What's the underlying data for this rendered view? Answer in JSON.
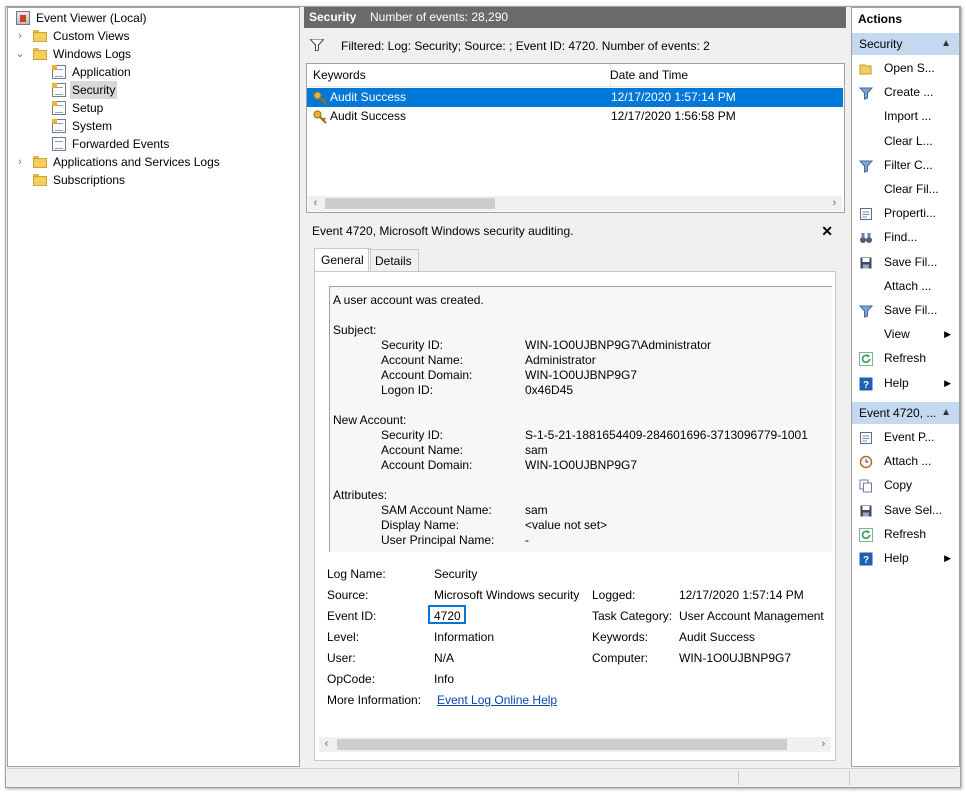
{
  "tree": {
    "root": "Event Viewer (Local)",
    "items": [
      {
        "label": "Custom Views"
      },
      {
        "label": "Windows Logs"
      },
      {
        "label": "Application"
      },
      {
        "label": "Security"
      },
      {
        "label": "Setup"
      },
      {
        "label": "System"
      },
      {
        "label": "Forwarded Events"
      },
      {
        "label": "Applications and Services Logs"
      },
      {
        "label": "Subscriptions"
      }
    ]
  },
  "log_header": {
    "title": "Security",
    "count": "Number of events: 28,290"
  },
  "filter_text": "Filtered: Log: Security; Source: ; Event ID: 4720. Number of events: 2",
  "columns": {
    "keywords": "Keywords",
    "datetime": "Date and Time"
  },
  "events": [
    {
      "keywords": "Audit Success",
      "datetime": "12/17/2020 1:57:14 PM"
    },
    {
      "keywords": "Audit Success",
      "datetime": "12/17/2020 1:56:58 PM"
    }
  ],
  "details": {
    "title": "Event 4720, Microsoft Windows security auditing.",
    "close": "✕",
    "tabs": {
      "general": "General",
      "details": "Details"
    },
    "message": {
      "intro": "A user account was created.",
      "subject": "Subject:",
      "subject_rows": [
        {
          "k": "Security ID:",
          "v": "WIN-1O0UJBNP9G7\\Administrator"
        },
        {
          "k": "Account Name:",
          "v": "Administrator"
        },
        {
          "k": "Account Domain:",
          "v": "WIN-1O0UJBNP9G7"
        },
        {
          "k": "Logon ID:",
          "v": "0x46D45"
        }
      ],
      "new_account": "New Account:",
      "new_rows": [
        {
          "k": "Security ID:",
          "v": "S-1-5-21-1881654409-284601696-3713096779-1001"
        },
        {
          "k": "Account Name:",
          "v": "sam"
        },
        {
          "k": "Account Domain:",
          "v": "WIN-1O0UJBNP9G7"
        }
      ],
      "attributes": "Attributes:",
      "attr_rows": [
        {
          "k": "SAM Account Name:",
          "v": "sam"
        },
        {
          "k": "Display Name:",
          "v": "<value not set>"
        },
        {
          "k": "User Principal Name:",
          "v": "-"
        }
      ]
    },
    "fields": {
      "log_name_label": "Log Name:",
      "log_name": "Security",
      "source_label": "Source:",
      "source": "Microsoft Windows security",
      "logged_label": "Logged:",
      "logged": "12/17/2020 1:57:14 PM",
      "event_id_label": "Event ID:",
      "event_id": "4720",
      "task_label": "Task Category:",
      "task": "User Account Management",
      "level_label": "Level:",
      "level": "Information",
      "keywords_label": "Keywords:",
      "keywords": "Audit Success",
      "user_label": "User:",
      "user": "N/A",
      "computer_label": "Computer:",
      "computer": "WIN-1O0UJBNP9G7",
      "opcode_label": "OpCode:",
      "opcode": "Info",
      "more_label": "More Information:",
      "more_link": "Event Log Online Help"
    }
  },
  "actions": {
    "header": "Actions",
    "section1": "Security",
    "items1": [
      {
        "label": "Open S...",
        "icon": "folder-open-icon"
      },
      {
        "label": "Create ...",
        "icon": "filter-icon"
      },
      {
        "label": "Import ...",
        "icon": "none"
      },
      {
        "label": "Clear L...",
        "icon": "none"
      },
      {
        "label": "Filter C...",
        "icon": "filter-icon"
      },
      {
        "label": "Clear Fil...",
        "icon": "none"
      },
      {
        "label": "Properti...",
        "icon": "properties-icon"
      },
      {
        "label": "Find...",
        "icon": "binoculars-icon"
      },
      {
        "label": "Save Fil...",
        "icon": "save-icon"
      },
      {
        "label": "Attach ...",
        "icon": "none"
      },
      {
        "label": "Save Fil...",
        "icon": "filter-icon"
      },
      {
        "label": "View",
        "icon": "none"
      },
      {
        "label": "Refresh",
        "icon": "refresh-icon"
      },
      {
        "label": "Help",
        "icon": "help-icon"
      }
    ],
    "section2": "Event 4720, ...",
    "items2": [
      {
        "label": "Event P...",
        "icon": "properties-icon"
      },
      {
        "label": "Attach ...",
        "icon": "task-icon"
      },
      {
        "label": "Copy",
        "icon": "copy-icon"
      },
      {
        "label": "Save Sel...",
        "icon": "save-icon"
      },
      {
        "label": "Refresh",
        "icon": "refresh-icon"
      },
      {
        "label": "Help",
        "icon": "help-icon"
      }
    ]
  },
  "colors": {
    "selection": "#0078d7",
    "header_bg": "#6a6a6a",
    "action_section": "#c4d9ef",
    "link": "#0645ad"
  }
}
